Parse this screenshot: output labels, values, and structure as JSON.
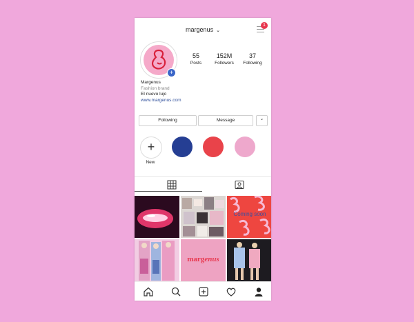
{
  "header": {
    "username": "margenus",
    "chevron": "⌄",
    "notification_count": "1"
  },
  "profile": {
    "posts": {
      "value": "55",
      "label": "Posts"
    },
    "followers": {
      "value": "152M",
      "label": "Followers"
    },
    "following": {
      "value": "37",
      "label": "Following"
    },
    "name": "Margenus",
    "category": "Fashion brand",
    "bio": "El nuevo lujo",
    "website": "www.margenus.com"
  },
  "actions": {
    "following_label": "Following",
    "message_label": "Message",
    "dropdown_glyph": "⌄"
  },
  "highlights": [
    {
      "label": "New",
      "glyph": "+"
    },
    {
      "color": "#253e93"
    },
    {
      "color": "#e9434a"
    },
    {
      "color": "#eea8cc"
    }
  ],
  "posts_grid": {
    "coming_soon_text": "Coming soon",
    "logo_text_a": "marg",
    "logo_text_b": "enus"
  },
  "colors": {
    "brand_pink": "#f5a9c9",
    "brand_red": "#e8384f",
    "background": "#f0a8dc"
  },
  "icons": [
    "menu-icon",
    "grid-icon",
    "tagged-icon",
    "home-icon",
    "search-icon",
    "add-post-icon",
    "heart-icon",
    "profile-icon"
  ]
}
